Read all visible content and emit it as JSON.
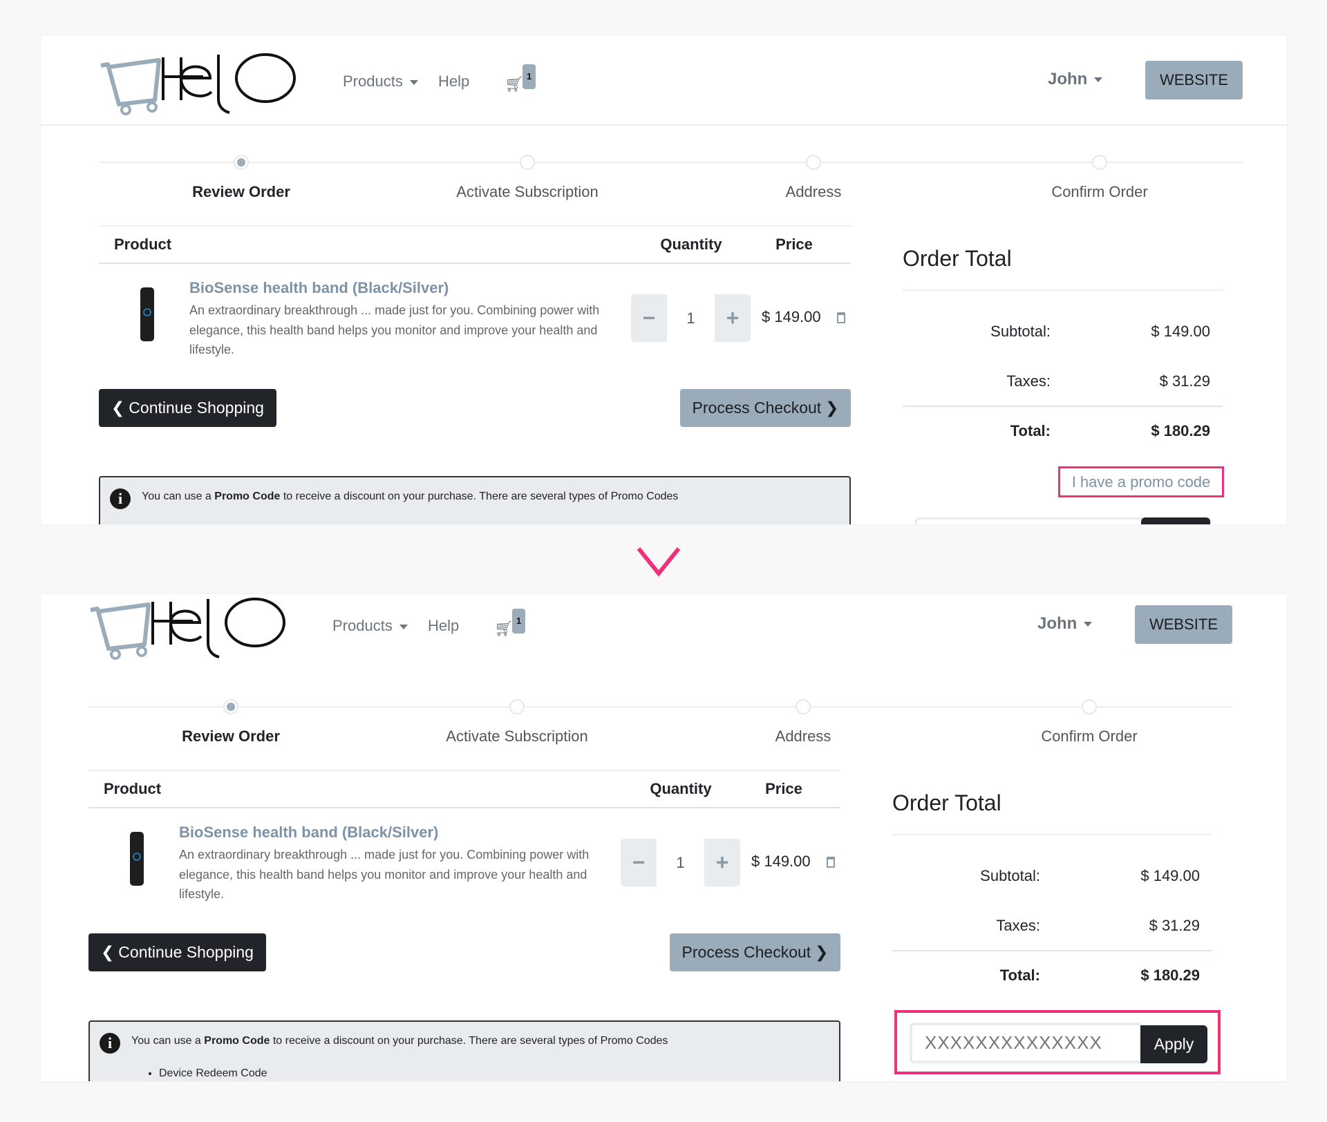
{
  "header": {
    "nav": [
      {
        "label": "Products"
      },
      {
        "label": "Help"
      }
    ],
    "cart_count": "1",
    "user": "John",
    "website_label": "WEBSITE"
  },
  "steps": [
    {
      "label": "Review Order",
      "active": true
    },
    {
      "label": "Activate Subscription"
    },
    {
      "label": "Address"
    },
    {
      "label": "Confirm Order"
    }
  ],
  "table": {
    "headers": {
      "product": "Product",
      "quantity": "Quantity",
      "price": "Price"
    },
    "item": {
      "name": "BioSense health band (Black/Silver)",
      "description": "An extraordinary breakthrough ... made just for you. Combining power with elegance, this health band helps you monitor and improve your health and lifestyle.",
      "quantity": "1",
      "price": "$ 149.00"
    }
  },
  "buttons": {
    "continue": "Continue Shopping",
    "checkout": "Process Checkout"
  },
  "info": {
    "pre": "You can use a ",
    "bold": "Promo Code",
    "post": " to receive a discount on your purchase.  There are several types of Promo Codes",
    "bullet": "Device Redeem Code"
  },
  "order_total": {
    "title": "Order Total",
    "subtotal_label": "Subtotal:",
    "subtotal": "$ 149.00",
    "taxes_label": "Taxes:",
    "taxes": "$ 31.29",
    "total_label": "Total:",
    "total": "$ 180.29"
  },
  "promo": {
    "link": "I have a promo code",
    "placeholder": "XXXXXXXXXXXXXX",
    "apply": "Apply"
  },
  "colors": {
    "highlight": "#f0307a",
    "accent": "#9aabba",
    "dark": "#212529"
  }
}
